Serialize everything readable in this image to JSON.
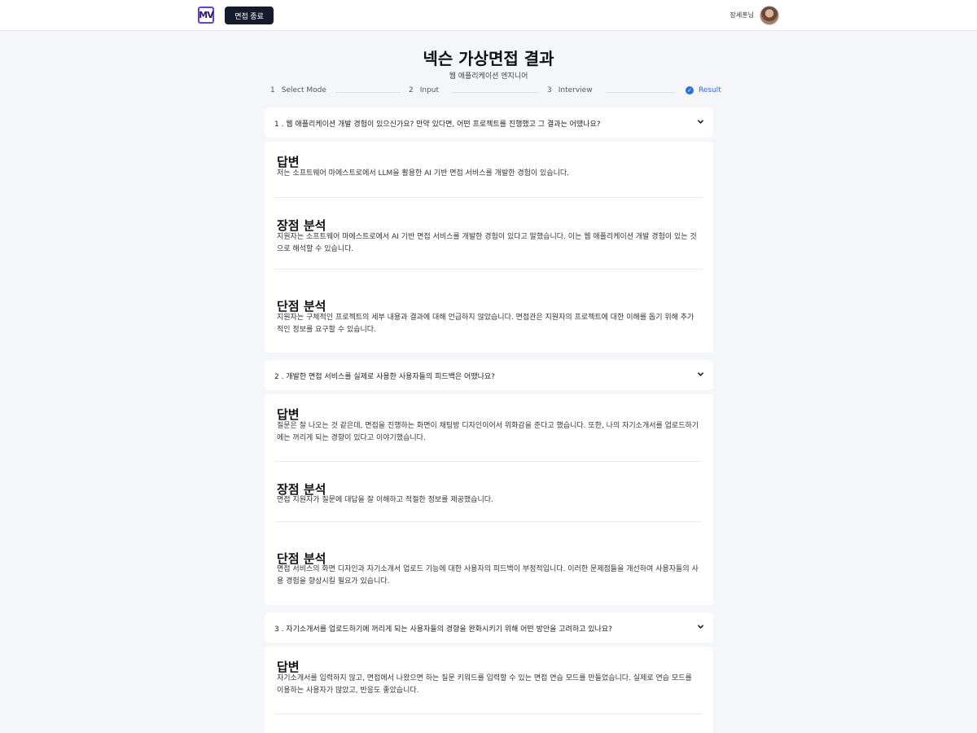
{
  "header": {
    "logo_text": "MV",
    "end_button": "면접 종료",
    "username": "장세훈님"
  },
  "page": {
    "title": "넥슨 가상면접 결과",
    "subtitle": "웹 애플리케이션 엔지니어"
  },
  "steps": [
    {
      "num": "1",
      "label": "Select Mode"
    },
    {
      "num": "2",
      "label": "Input"
    },
    {
      "num": "3",
      "label": "Interview"
    },
    {
      "num": "",
      "label": "Result"
    }
  ],
  "labels": {
    "answer": "답변",
    "strength": "장점 분석",
    "weakness": "단점 분석"
  },
  "questions": [
    {
      "text": "1 . 웹 애플리케이션 개발 경험이 있으신가요? 만약 있다면, 어떤 프로젝트를 진행했고 그 결과는 어땠나요?",
      "answer": "저는 소프트웨어 마에스트로에서 LLM을 활용한 AI 기반 면접 서비스를 개발한 경험이 있습니다.",
      "strength": "지원자는 소프트웨어 마에스트로에서 AI 기반 면접 서비스를 개발한 경험이 있다고 말했습니다. 이는 웹 애플리케이션 개발 경험이 있는 것으로 해석할 수 있습니다.",
      "weakness": "지원자는 구체적인 프로젝트의 세부 내용과 결과에 대해 언급하지 않았습니다. 면접관은 지원자의 프로젝트에 대한 이해를 돕기 위해 추가적인 정보를 요구할 수 있습니다."
    },
    {
      "text": "2 . 개발한 면접 서비스를 실제로 사용한 사용자들의 피드백은 어땠나요?",
      "answer": "질문은 잘 나오는 것 같은데, 면접을 진행하는 화면이 채팅방 디자인이어서 위화감을 준다고 했습니다. 또한, 나의 자기소개서를 업로드하기에는 꺼리게 되는 경향이 있다고 이야기했습니다.",
      "strength": "면접 지원자가 질문에 대답을 잘 이해하고 적절한 정보를 제공했습니다.",
      "weakness": "면접 서비스의 화면 디자인과 자기소개서 업로드 기능에 대한 사용자의 피드백이 부정적입니다. 이러한 문제점들을 개선하여 사용자들의 사용 경험을 향상시킬 필요가 있습니다."
    },
    {
      "text": "3 . 자기소개서를 업로드하기에 꺼리게 되는 사용자들의 경향을 완화시키기 위해 어떤 방안을 고려하고 있나요?",
      "answer": "자기소개서를 입력하지 않고, 면접에서 나왔으면 하는 질문 키워드를 입력할 수 있는 면접 연습 모드를 만들었습니다. 실제로 연습 모드를 이용하는 사용자가 많았고, 반응도 좋았습니다."
    }
  ],
  "colors": {
    "accent": "#2b6fd6",
    "button_bg": "#141b2b",
    "page_bg": "#f4f6f9",
    "logo_border": "#6b3fd6"
  },
  "icons": [
    "chevron-down-icon",
    "check-circle-icon",
    "avatar"
  ]
}
